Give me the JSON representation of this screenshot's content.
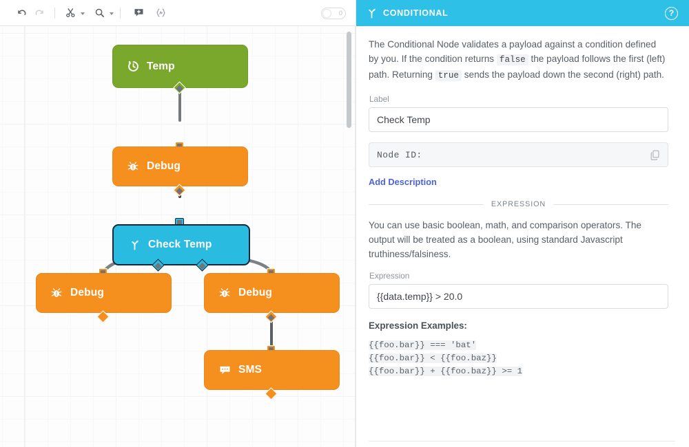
{
  "toolbar": {
    "buttons": [
      {
        "name": "undo",
        "icon": "undo-icon",
        "disabled": false
      },
      {
        "name": "redo",
        "icon": "redo-icon",
        "disabled": true
      },
      {
        "name": "cut",
        "icon": "scissors-icon",
        "disabled": false,
        "has_caret": true
      },
      {
        "name": "zoom",
        "icon": "magnifier-icon",
        "disabled": false,
        "has_caret": true
      },
      {
        "name": "add-comment",
        "icon": "add-comment-icon",
        "disabled": false
      },
      {
        "name": "mustache-template",
        "icon": "brackets-icon",
        "disabled": false
      }
    ],
    "toggle": {
      "label": "",
      "state": "off",
      "marker": "0"
    }
  },
  "canvas": {
    "nodes": [
      {
        "id": "temp",
        "label": "Temp",
        "type": "timer",
        "color": "#7aa82c",
        "icon": "timer-icon",
        "selected": false
      },
      {
        "id": "debug1",
        "label": "Debug",
        "type": "debug",
        "color": "#f5901f",
        "icon": "bug-icon",
        "selected": false
      },
      {
        "id": "checktemp",
        "label": "Check Temp",
        "type": "conditional",
        "color": "#2abce0",
        "icon": "branch-icon",
        "selected": true
      },
      {
        "id": "debug2",
        "label": "Debug",
        "type": "debug",
        "color": "#f5901f",
        "icon": "bug-icon",
        "selected": false
      },
      {
        "id": "debug3",
        "label": "Debug",
        "type": "debug",
        "color": "#f5901f",
        "icon": "bug-icon",
        "selected": false
      },
      {
        "id": "sms",
        "label": "SMS",
        "type": "sms",
        "color": "#f5901f",
        "icon": "sms-icon",
        "selected": false
      }
    ],
    "connections": [
      {
        "from": "temp",
        "to": "debug1"
      },
      {
        "from": "debug1",
        "to": "checktemp"
      },
      {
        "from": "checktemp",
        "to": "debug2",
        "branch": "false"
      },
      {
        "from": "checktemp",
        "to": "debug3",
        "branch": "true"
      },
      {
        "from": "debug3",
        "to": "sms"
      }
    ]
  },
  "panel": {
    "header": {
      "title": "CONDITIONAL",
      "icon": "branch-icon",
      "help_label": "?",
      "bg_color": "#2fc0e8"
    },
    "description": {
      "part1": "The Conditional Node validates a payload against a condition defined by you. If the condition returns ",
      "code1": "false",
      "part2": " the payload follows the first (left) path. Returning ",
      "code2": "true",
      "part3": " sends the payload down the second (right) path."
    },
    "label_field": {
      "label": "Label",
      "value": "Check Temp",
      "placeholder": "Label"
    },
    "node_id_field": {
      "text": "Node ID:",
      "copy_icon": "copy-icon"
    },
    "add_description_link": "Add Description",
    "expression_section": {
      "divider_title": "EXPRESSION",
      "help_text": "You can use basic boolean, math, and comparison operators. The output will be treated as a boolean, using standard Javascript truthiness/falsiness.",
      "field_label": "Expression",
      "value": "{{data.temp}} > 20.0",
      "placeholder": "Expression",
      "examples_title": "Expression Examples:",
      "examples": [
        "{{foo.bar}} === 'bat'",
        "{{foo.bar}} < {{foo.baz}}",
        "{{foo.bar}} + {{foo.baz}} >= 1"
      ]
    }
  }
}
